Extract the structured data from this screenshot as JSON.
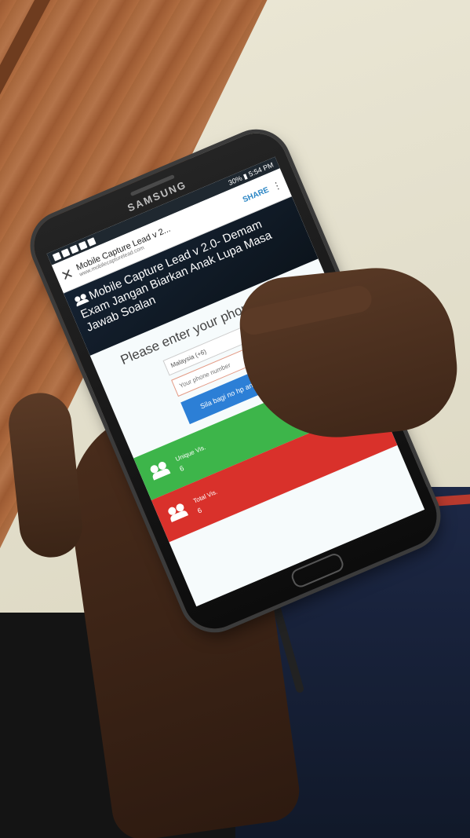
{
  "phone": {
    "brand": "SAMSUNG",
    "status": {
      "time": "5:54 PM",
      "battery": "30%"
    },
    "browser": {
      "page_title": "Mobile Capture Lead v 2...",
      "url": "www.mobilecapturelead.com",
      "share_label": "SHARE"
    },
    "page": {
      "title": "Mobile Capture Lead v 2.0- Demam Exam Jangan Biarkan Anak Lupa Masa Jawab Soalan",
      "prompt": "Please enter your phone number",
      "country_select": "Malaysia (+6)",
      "phone_placeholder": "Your phone number",
      "share_button": "Sila bagi no hp anda di sini"
    },
    "stats": [
      {
        "label": "Unique Vis.",
        "value": "6",
        "color": "#3db54a"
      },
      {
        "label": "Total Vis.",
        "value": "6",
        "color": "#d9312b"
      }
    ]
  }
}
